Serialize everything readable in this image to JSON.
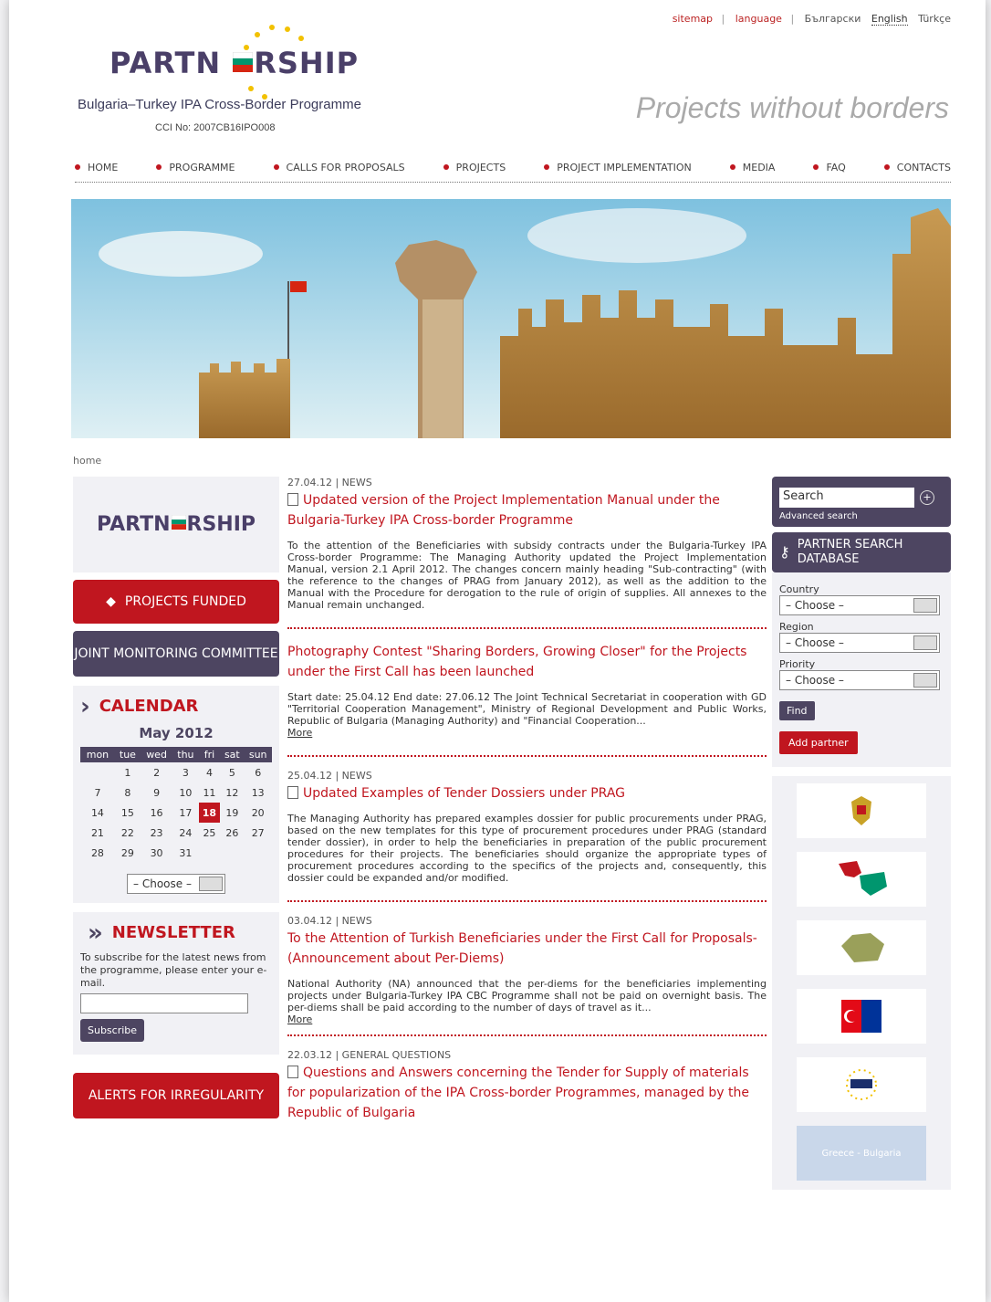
{
  "topbar": {
    "sitemap": "sitemap",
    "language": "language",
    "bg": "Български",
    "en": "English",
    "tr": "Türkçe"
  },
  "brand": {
    "logo": "PARTN",
    "logo_end": "RSHIP",
    "programme": "Bulgaria–Turkey IPA Cross-Border Programme",
    "cci": "CCI No: 2007CB16IPO008",
    "slogan": "Projects without borders"
  },
  "nav": [
    "HOME",
    "PROGRAMME",
    "CALLS FOR PROPOSALS",
    "PROJECTS",
    "PROJECT IMPLEMENTATION",
    "MEDIA",
    "FAQ",
    "CONTACTS"
  ],
  "breadcrumb": "home",
  "left": {
    "projects_funded": "PROJECTS FUNDED",
    "joint_monitoring": "JOINT MONITORING COMMITTEE",
    "calendar_title": "CALENDAR",
    "calendar_month": "May 2012",
    "calendar_days": [
      "mon",
      "tue",
      "wed",
      "thu",
      "fri",
      "sat",
      "sun"
    ],
    "calendar_select": "– Choose –",
    "newsletter_title": "NEWSLETTER",
    "newsletter_text": "To subscribe for the latest news from the programme, please enter your e-mail.",
    "subscribe": "Subscribe",
    "alerts": "ALERTS FOR IRREGULARITY"
  },
  "posts": [
    {
      "meta": "27.04.12 | NEWS",
      "title": "Updated version of the Project Implementation Manual under the Bulgaria-Turkey IPA Cross-border Programme",
      "body": "To the attention of the Beneficiaries with subsidy contracts under the Bulgaria-Turkey IPA Cross-border Programme: The Managing Authority updated the Project Implementation Manual, version 2.1 April 2012. The changes concern mainly heading \"Sub-contracting\" (with the reference to the changes of PRAG from January 2012), as well as the addition to the Manual with the Procedure for derogation to the rule of origin of supplies. All annexes to the Manual remain unchanged.",
      "more": ""
    },
    {
      "meta": "",
      "title": "Photography Contest \"Sharing Borders, Growing Closer\" for the Projects under the First Call has been launched",
      "body": "Start date: 25.04.12  End date: 27.06.12  The Joint Technical Secretariat in cooperation with GD \"Territorial Cooperation Management\", Ministry of Regional Development and Public Works, Republic of Bulgaria (Managing Authority) and \"Financial Cooperation...",
      "more": "More"
    },
    {
      "meta": "25.04.12 | NEWS",
      "title": "Updated Examples of Tender Dossiers under PRAG",
      "body": "The Managing Authority has prepared examples dossier for public procurements under PRAG, based on the new templates for this type of procurement procedures under PRAG (standard tender dossier), in order to help the beneficiaries in preparation of the public procurement procedures for their projects. The beneficiaries should organize the appropriate types of procurement procedures according to the specifics of the projects and, consequently, this dossier could be expanded and/or modified.",
      "more": ""
    },
    {
      "meta": "03.04.12 | NEWS",
      "title": "To the Attention of Turkish Beneficiaries under the First Call for Proposals-(Announcement about Per-Diems)",
      "body": "National Authority (NA) announced that the per-diems for the beneficiaries implementing projects under Bulgaria-Turkey IPA CBC Programme shall not be paid on overnight basis. The per-diems shall be paid according to the number of days of travel as it...",
      "more": "More"
    },
    {
      "meta": "22.03.12 | GENERAL QUESTIONS",
      "title": "Questions and Answers concerning the Tender for Supply of materials for popularization of the IPA Cross-border Programmes, managed by the Republic of Bulgaria",
      "body": "",
      "more": ""
    }
  ],
  "right": {
    "search_value": "Search",
    "advanced": "Advanced search",
    "psd_title": "PARTNER SEARCH DATABASE",
    "country": "Country",
    "region": "Region",
    "priority": "Priority",
    "choose": "– Choose –",
    "find": "Find",
    "add_partner": "Add partner",
    "greece_bulgaria": "Greece - Bulgaria"
  }
}
